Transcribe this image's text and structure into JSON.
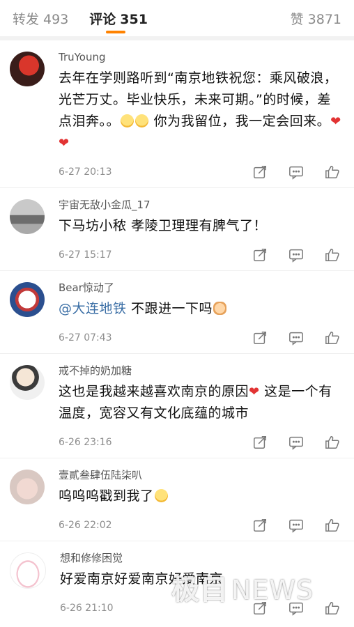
{
  "tabs": {
    "repost_label": "转发",
    "repost_count": "493",
    "comment_label": "评论",
    "comment_count": "351",
    "like_label": "赞",
    "like_count": "3871"
  },
  "colors": {
    "accent": "#ff8200",
    "mention": "#3a6ea5",
    "heart": "#e23333"
  },
  "comments": [
    {
      "name": "TruYoung",
      "text": "去年在学则路听到“南京地铁祝您：乘风破浪，光芒万丈。毕业快乐，未来可期。”的时候，差点泪奔。。",
      "text2": "你为我留位，我一定会回来。",
      "time": "6-27 20:13"
    },
    {
      "name": "宇宙无敌小金瓜_17",
      "text": "下马坊小秾 孝陵卫理理有脾气了！",
      "time": "6-27 15:17"
    },
    {
      "name": "Bear惊动了",
      "mention": "@大连地铁",
      "text": " 不跟进一下吗",
      "time": "6-27 07:43"
    },
    {
      "name": "戒不掉的奶加糖",
      "text": "这也是我越来越喜欢南京的原因",
      "text2": " 这是一个有温度，宽容又有文化底蕴的城市",
      "time": "6-26 23:16"
    },
    {
      "name": "壹貳叁肆伍陆柒叭",
      "text": "呜呜呜戳到我了",
      "time": "6-26 22:02"
    },
    {
      "name": "想和修修困觉",
      "text": "好爱南京好爱南京好爱南京",
      "time": "6-26 21:10"
    }
  ],
  "icons": [
    "repost-icon",
    "comment-icon",
    "like-icon"
  ],
  "watermark": {
    "cn": "极目",
    "en": "NEWS"
  }
}
